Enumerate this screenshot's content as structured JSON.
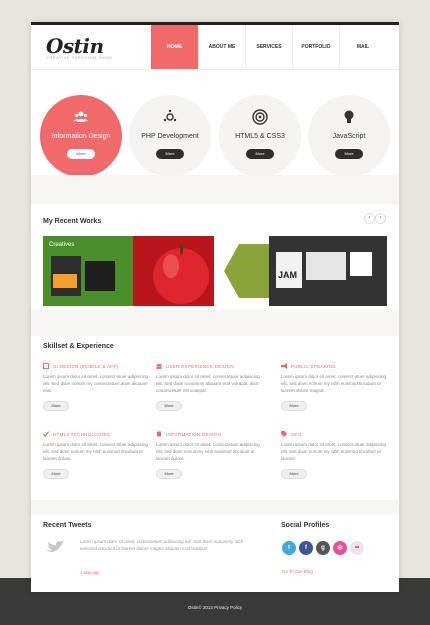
{
  "header": {
    "logo": "Ostin",
    "tagline": "CREATIVE PERSONAL PAGE",
    "nav": [
      "HOME",
      "ABOUT ME",
      "SERVICES",
      "PORTFOLIO",
      "MAIL"
    ]
  },
  "services": [
    {
      "title": "Information Design",
      "button": "More",
      "icon": "users-icon"
    },
    {
      "title": "PHP Development",
      "button": "More",
      "icon": "gears-icon"
    },
    {
      "title": "HTML5 & CSS3",
      "button": "More",
      "icon": "target-icon"
    },
    {
      "title": "JavaScript",
      "button": "More",
      "icon": "lightbulb-icon"
    }
  ],
  "works": {
    "title": "My Recent Works",
    "prev": "‹",
    "next": "›",
    "item_text": [
      "Creatives",
      "JAM"
    ]
  },
  "skills": {
    "title": "Skillset & Experience",
    "items": [
      {
        "title": "UI DESIGN (MOBILE & APP)",
        "text": "Lorem ipsum dolor sit amet, consect etuer adipiscing elit. Sed diam nonum my consectetuer diam aliquam erat.",
        "button": "More",
        "icon": "document-icon"
      },
      {
        "title": "USER EXPERIENCE DESIGN",
        "text": "Lorem ipsum dolor sit amet, consectetuer adipiscing elit. Sed diam nonummy aliquam erat volutpat, diam consectetuer elit volutpat.",
        "button": "More",
        "icon": "people-icon"
      },
      {
        "title": "PUBLIC SPEAKING",
        "text": "Lorem ipsum dolor sit amet, consect etuer adipiscing elit, sed diam nonum my nibh euismod tincidunt ut laoreet dolore magna.",
        "button": "More",
        "icon": "megaphone-icon"
      },
      {
        "title": "HTML5 TECHNOLOGIES",
        "text": "Lorem ipsum dolor sit amet, consect etuer adipiscing elit, sed diam nonum my nibh euismod tincidunt ut laoreet dolore.",
        "button": "More",
        "icon": "check-icon"
      },
      {
        "title": "INFORMATION DESIGN",
        "text": "Lorem ipsum dolor sit amet, consectetuer adipiscing elit, sed diam nonummy nibh euismod tincidunt ut laoreet dolore.",
        "button": "More",
        "icon": "book-icon"
      },
      {
        "title": "SEO",
        "text": "Lorem ipsum dolor sit amet, consect etuer adipiscing elit, sed diam nonum my nibh euismod tincidunt ut laoreet.",
        "button": "More",
        "icon": "tag-icon"
      }
    ]
  },
  "tweets": {
    "title": "Recent Tweets",
    "text": "Lorem ipsum dolor sit amet, consectetuer adipiscing elit. Sed diam nonummy nibh euismod tincidunt ut laoreet dolore magna aliquam erat volutpat.",
    "time": "1 day ago",
    "icon": "bird-icon"
  },
  "social": {
    "title": "Social Profiles",
    "link": "Go To Our Blog",
    "icons": [
      {
        "name": "twitter-icon",
        "glyph": "t",
        "color": "#3fa9e0"
      },
      {
        "name": "facebook-icon",
        "glyph": "f",
        "color": "#3b5998"
      },
      {
        "name": "google-plus-icon",
        "glyph": "g",
        "color": "#555555"
      },
      {
        "name": "dribbble-icon",
        "glyph": "◎",
        "color": "#e5539b"
      },
      {
        "name": "flickr-icon",
        "glyph": "••",
        "color": "#e6e6e6"
      }
    ]
  },
  "footer": {
    "text": "Ostin© 2013 Privacy Policy"
  },
  "colors": {
    "accent": "#f06a6c",
    "dark": "#2e2e2e"
  }
}
